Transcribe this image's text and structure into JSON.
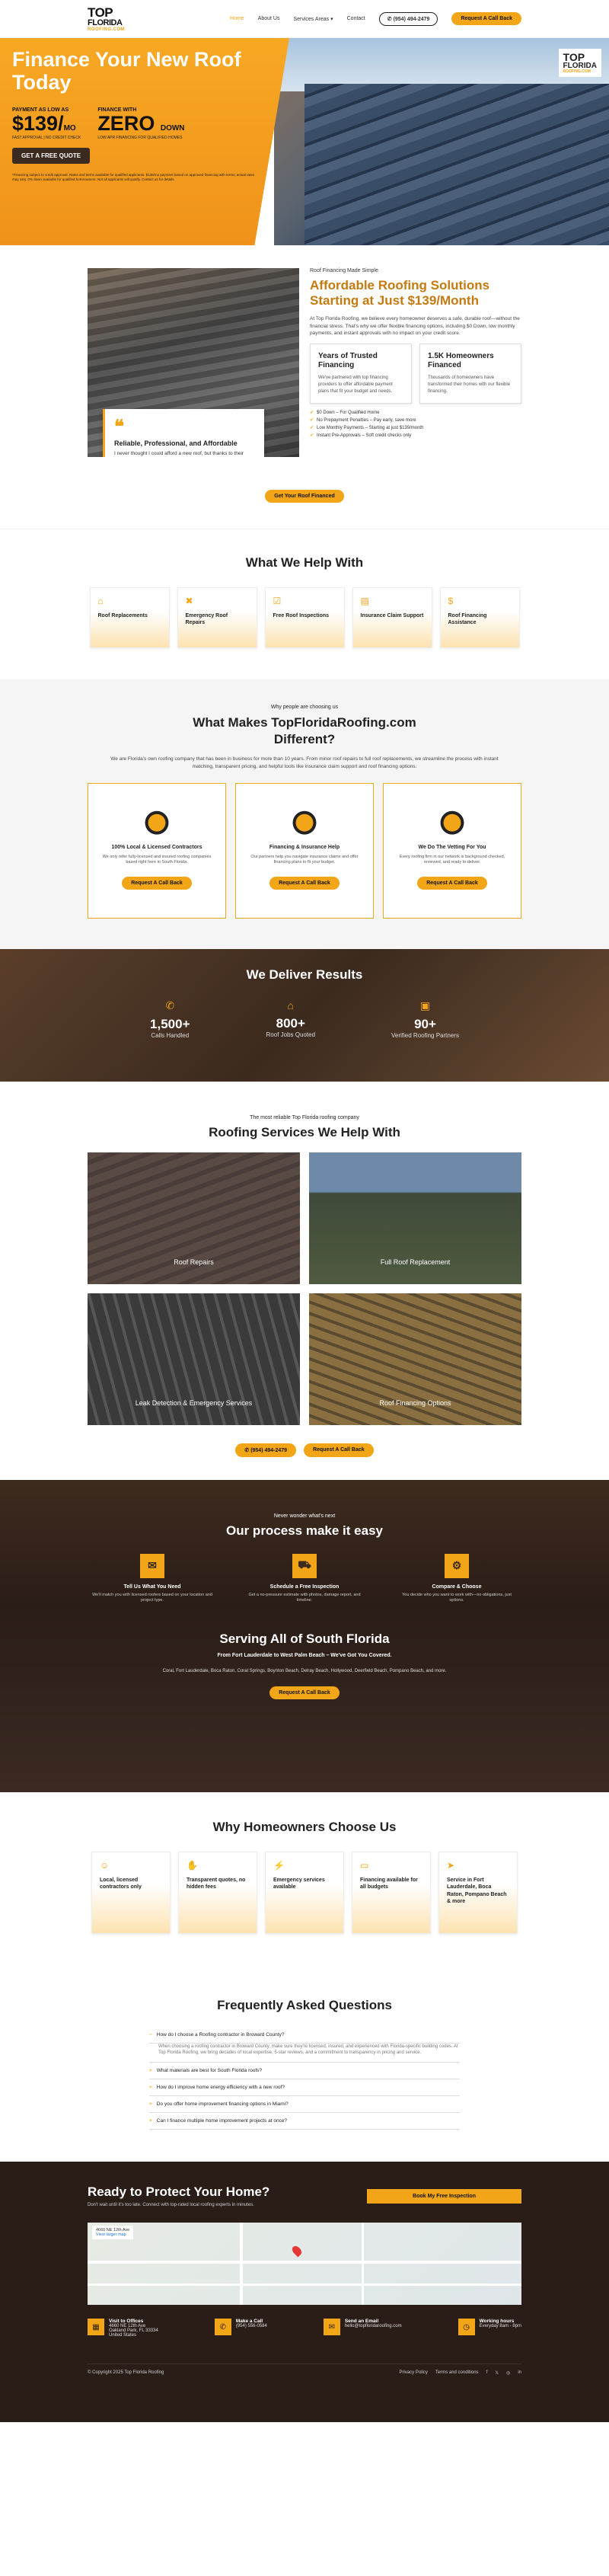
{
  "header": {
    "logo_top": "TOP",
    "logo_mid": "FLORIDA",
    "logo_sub": "ROOFING.COM",
    "nav": [
      "Home",
      "About Us",
      "Services Areas ▾",
      "Contact"
    ],
    "phone": "(954) 494-2479",
    "cta": "Request A Call Back"
  },
  "hero": {
    "title": "Finance Your New Roof Today",
    "offer1_label": "PAYMENT AS LOW AS",
    "offer1_value": "$139/",
    "offer1_unit": "MO",
    "offer1_sub": "FAST APPROVAL | NO CREDIT CHECK",
    "offer2_label": "FINANCE WITH",
    "offer2_value": "ZERO",
    "offer2_unit": "DOWN",
    "offer2_sub": "LOW APR FINANCING FOR QUALIFIED HOMES",
    "button": "GET A FREE QUOTE",
    "fine_print": "*Financing subject to credit approval. Rates and terms available for qualified applicants. $139/mo payment based on approved financing with terms; actual rates may vary. 0% down available for qualified homeowners. Not all applicants will qualify. Contact us for details."
  },
  "about": {
    "quote_title": "Reliable, Professional, and Affordable",
    "quote_text": "I never thought I could afford a new roof, but thanks to their financing options, I got a high-quality installation without upfront costs. Highly recommended!",
    "kicker": "Roof Financing Made Simple",
    "title": "Affordable Roofing Solutions Starting at Just $139/Month",
    "text": "At Top Florida Roofing, we believe every homeowner deserves a safe, durable roof—without the financial stress. That's why we offer flexible financing options, including $0 Down, low monthly payments, and instant approvals with no impact on your credit score.",
    "card1_title": "Years of Trusted Financing",
    "card1_text": "We've partnered with top financing providers to offer affordable payment plans that fit your budget and needs.",
    "card2_title": "1.5K Homeowners Financed",
    "card2_text": "Thousands of homeowners have transformed their homes with our flexible financing.",
    "checks": [
      "$0 Down – For Qualified Home",
      "No Prepayment Penalties – Pay early, save more",
      "Low Monthly Payments – Starting at just $139/month",
      "Instant Pre-Approvals – Soft credit checks only"
    ],
    "button": "Get Your Roof Financed"
  },
  "help": {
    "title": "What We Help With",
    "items": [
      "Roof Replacements",
      "Emergency Roof Repairs",
      "Free Roof Inspections",
      "Insurance Claim Support",
      "Roof Financing Assistance"
    ]
  },
  "makes": {
    "kicker": "Why people are choosing us",
    "title": "What Makes TopFloridaRoofing.com Different?",
    "intro": "We are Florida's own roofing company that has been in business for more than 10 years. From minor roof repairs to full roof replacements, we streamline the process with instant matching, transparent pricing, and helpful tools like insurance claim support and roof financing options.",
    "cards": [
      {
        "title": "100% Local & Licensed Contractors",
        "text": "We only refer fully-licensed and insured roofing companies based right here in South Florida.",
        "btn": "Request A Call Back"
      },
      {
        "title": "Financing & Insurance Help",
        "text": "Our partners help you navigate insurance claims and offer financing plans to fit your budget.",
        "btn": "Request A Call Back"
      },
      {
        "title": "We Do The Vetting For You",
        "text": "Every roofing firm in our network is background checked, reviewed, and ready to deliver.",
        "btn": "Request A Call Back"
      }
    ]
  },
  "results": {
    "title": "We Deliver Results",
    "stats": [
      {
        "num": "1,500+",
        "label": "Calls Handled"
      },
      {
        "num": "800+",
        "label": "Roof Jobs Quoted"
      },
      {
        "num": "90+",
        "label": "Verified Roofing Partners"
      }
    ]
  },
  "services": {
    "kicker": "The most reliable Top Florida roofing company",
    "title": "Roofing Services We Help With",
    "items": [
      "Roof Repairs",
      "Full Roof Replacement",
      "Leak Detection & Emergency Services",
      "Roof Financing Options"
    ],
    "phone": "(954) 494-2479",
    "cta": "Request A Call Back"
  },
  "process": {
    "kicker": "Never wonder what's next",
    "title": "Our process make it easy",
    "steps": [
      {
        "title": "Tell Us What You Need",
        "text": "We'll match you with licensed roofers based on your location and project type."
      },
      {
        "title": "Schedule a Free Inspection",
        "text": "Get a no-pressure estimate with photos, damage report, and timeline."
      },
      {
        "title": "Compare & Choose",
        "text": "You decide who you want to work with—no obligations, just options."
      }
    ],
    "area_title": "Serving All of South Florida",
    "area_sub": "From Fort Lauderdale to West Palm Beach – We've Got You Covered.",
    "cities": "Coral, Fort Lauderdale, Boca Raton, Coral Springs, Boynton Beach, Delray Beach, Hollywood, Deerfield Beach, Pompano Beach, and more.",
    "cta": "Request A Call Back"
  },
  "why": {
    "title": "Why Homeowners Choose Us",
    "items": [
      "Local, licensed contractors only",
      "Transparent quotes, no hidden fees",
      "Emergency services available",
      "Financing available for all budgets",
      "Service in Fort Lauderdale, Boca Raton, Pompano Beach & more"
    ]
  },
  "faq": {
    "title": "Frequently Asked Questions",
    "open_q": "How do I choose a Roofing contractor in Broward County?",
    "open_a": "When choosing a roofing contractor in Broward County, make sure they're licensed, insured, and experienced with Florida-specific building codes. At Top Florida Roofing, we bring decades of local expertise, 5-star reviews, and a commitment to transparency in pricing and service.",
    "questions": [
      "What materials are best for South Florida roofs?",
      "How do I improve home energy efficiency with a new roof?",
      "Do you offer home improvement financing options in Miami?",
      "Can I finance multiple home improvement projects at once?"
    ]
  },
  "footer": {
    "title": "Ready to Protect Your Home?",
    "sub": "Don't wait until it's too late. Connect with top-rated local roofing experts in minutes.",
    "book": "Book My Free Inspection",
    "map_label": "4660 NE 12th Ave",
    "map_link": "View larger map",
    "visit_t": "Visit to Offices",
    "visit_1": "4660 NE 12th Ave",
    "visit_2": "Oakland Park, FL 33334",
    "visit_3": "United States",
    "call_t": "Make a Call",
    "call_v": "(954) 556-0584",
    "mail_t": "Send an Email",
    "mail_v": "hello@topfloridaroofing.com",
    "hours_t": "Working hours",
    "hours_v": "Everyday 8am - 8pm",
    "copy": "© Copyright 2025 Top Florida Roofing",
    "privacy": "Privacy Policy",
    "terms": "Terms and conditions"
  }
}
